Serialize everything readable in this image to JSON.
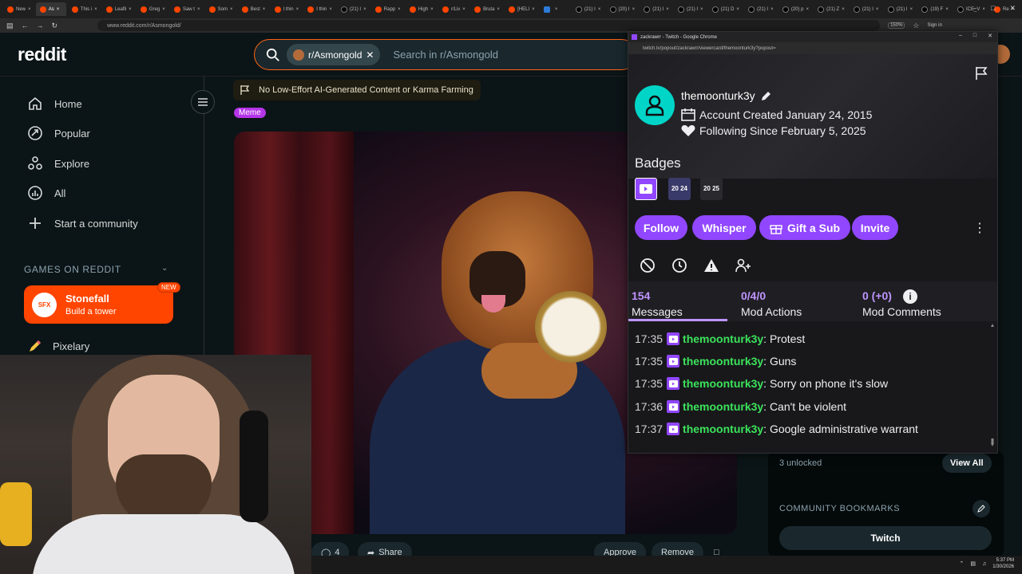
{
  "browser": {
    "tabs": [
      {
        "label": "New",
        "icon": "reddit"
      },
      {
        "label": "As",
        "icon": "reddit",
        "active": true
      },
      {
        "label": "This i",
        "icon": "reddit"
      },
      {
        "label": "Leafli",
        "icon": "reddit"
      },
      {
        "label": "Greg",
        "icon": "reddit"
      },
      {
        "label": "Saw t",
        "icon": "reddit"
      },
      {
        "label": "Som",
        "icon": "reddit"
      },
      {
        "label": "Best",
        "icon": "reddit"
      },
      {
        "label": "I thin",
        "icon": "reddit"
      },
      {
        "label": "I thin",
        "icon": "reddit"
      },
      {
        "label": "(21) I",
        "icon": "x"
      },
      {
        "label": "Rapp",
        "icon": "reddit"
      },
      {
        "label": "High",
        "icon": "reddit"
      },
      {
        "label": "r/Liv",
        "icon": "reddit"
      },
      {
        "label": "Bruta",
        "icon": "reddit"
      },
      {
        "label": "[HELI",
        "icon": "reddit"
      },
      {
        "label": "",
        "icon": "blue"
      },
      {
        "label": "(21) I",
        "icon": "x"
      },
      {
        "label": "(20) I",
        "icon": "x"
      },
      {
        "label": "(21) I",
        "icon": "x"
      },
      {
        "label": "(21) I",
        "icon": "x"
      },
      {
        "label": "(21) D",
        "icon": "x"
      },
      {
        "label": "(21) I",
        "icon": "x"
      },
      {
        "label": "(20) p",
        "icon": "x"
      },
      {
        "label": "(21) Z",
        "icon": "x"
      },
      {
        "label": "(21) I",
        "icon": "x"
      },
      {
        "label": "(21) I",
        "icon": "x"
      },
      {
        "label": "(19) F",
        "icon": "x"
      },
      {
        "label": "ICE_V",
        "icon": "x"
      },
      {
        "label": "Re",
        "icon": "reddit"
      }
    ],
    "url": "www.reddit.com/r/Asmongold/",
    "zoom": "150%",
    "sign_in": "Sign in"
  },
  "reddit": {
    "logo": "reddit",
    "search_chip": "r/Asmongold",
    "search_placeholder": "Search in r/Asmongold",
    "sidebar": {
      "items": [
        {
          "label": "Home",
          "icon": "home-icon"
        },
        {
          "label": "Popular",
          "icon": "popular-icon"
        },
        {
          "label": "Explore",
          "icon": "explore-icon"
        },
        {
          "label": "All",
          "icon": "all-icon"
        },
        {
          "label": "Start a community",
          "icon": "plus-icon"
        }
      ],
      "games_title": "GAMES ON REDDIT",
      "stonefall": {
        "name": "Stonefall",
        "subtitle": "Build a tower",
        "badge": "NEW",
        "logo_text": "SFX"
      },
      "pixelary": "Pixelary"
    },
    "post": {
      "rule": "No Low-Effort AI-Generated Content or Karma Farming",
      "flair": "Meme",
      "comments": "4",
      "share": "Share",
      "approve": "Approve",
      "remove": "Remove"
    },
    "right": {
      "unlocked": "3 unlocked",
      "view_all": "View All",
      "bookmarks_title": "COMMUNITY BOOKMARKS",
      "bookmark_twitch": "Twitch"
    }
  },
  "twitch": {
    "window_title": "zackrawrr - Twitch - Google Chrome",
    "url": "twitch.tv/popout/zackrawrr/viewercard/themoonturk3y?popout=",
    "username": "themoonturk3y",
    "account_created": "Account Created January 24, 2015",
    "following_since": "Following Since February 5, 2025",
    "badges_title": "Badges",
    "badges": [
      {
        "name": "twitch-badge",
        "text": "",
        "color": "#9147ff"
      },
      {
        "name": "year-2024-badge",
        "text": "20 24",
        "color": "#3a3a6a"
      },
      {
        "name": "year-2025-badge",
        "text": "20 25",
        "color": "#2a2a2e"
      }
    ],
    "buttons": {
      "follow": "Follow",
      "whisper": "Whisper",
      "gift": "Gift a Sub",
      "invite": "Invite"
    },
    "tabs": [
      {
        "num": "154",
        "label": "Messages"
      },
      {
        "num": "0/4/0",
        "label": "Mod Actions"
      },
      {
        "num": "0 (+0)",
        "label": "Mod Comments"
      }
    ],
    "messages": [
      {
        "time": "17:35",
        "user": "themoonturk3y",
        "text": ": Protest"
      },
      {
        "time": "17:35",
        "user": "themoonturk3y",
        "text": ": Guns"
      },
      {
        "time": "17:35",
        "user": "themoonturk3y",
        "text": ": Sorry on phone it's slow"
      },
      {
        "time": "17:36",
        "user": "themoonturk3y",
        "text": ": Can't be violent"
      },
      {
        "time": "17:37",
        "user": "themoonturk3y",
        "text": ": Google administrative warrant"
      }
    ]
  },
  "taskbar": {
    "time": "5:37 PM",
    "date": "1/30/2026"
  }
}
